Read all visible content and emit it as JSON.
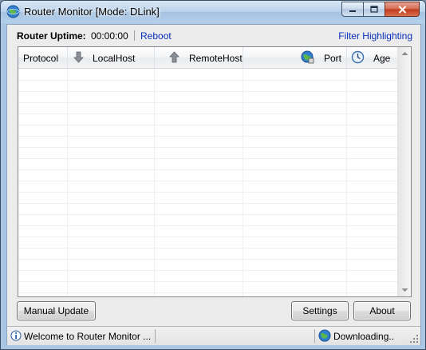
{
  "window": {
    "title": "Router Monitor [Mode: DLink]",
    "app_icon": "globe-network-icon",
    "caption_buttons": [
      "minimize-icon",
      "maximize-icon",
      "close-icon"
    ]
  },
  "info": {
    "uptime_label": "Router Uptime:",
    "uptime_value": "00:00:00",
    "reboot_label": "Reboot",
    "filter_label": "Filter Highlighting"
  },
  "table": {
    "columns": [
      {
        "label": "Protocol",
        "icon": ""
      },
      {
        "label": "LocalHost",
        "icon": "arrow-down-icon"
      },
      {
        "label": "RemoteHost",
        "icon": "arrow-up-icon"
      },
      {
        "label": "Port",
        "icon": "globe-port-icon"
      },
      {
        "label": "Age",
        "icon": "clock-icon"
      }
    ],
    "rows": []
  },
  "buttons": {
    "manual_update": "Manual Update",
    "settings": "Settings",
    "about": "About"
  },
  "status": {
    "message": "Welcome to Router Monitor ...",
    "activity": "Downloading.."
  },
  "colors": {
    "link": "#0a2fb8",
    "title_bar": "#b8d1ea",
    "close_button": "#c0391c"
  }
}
